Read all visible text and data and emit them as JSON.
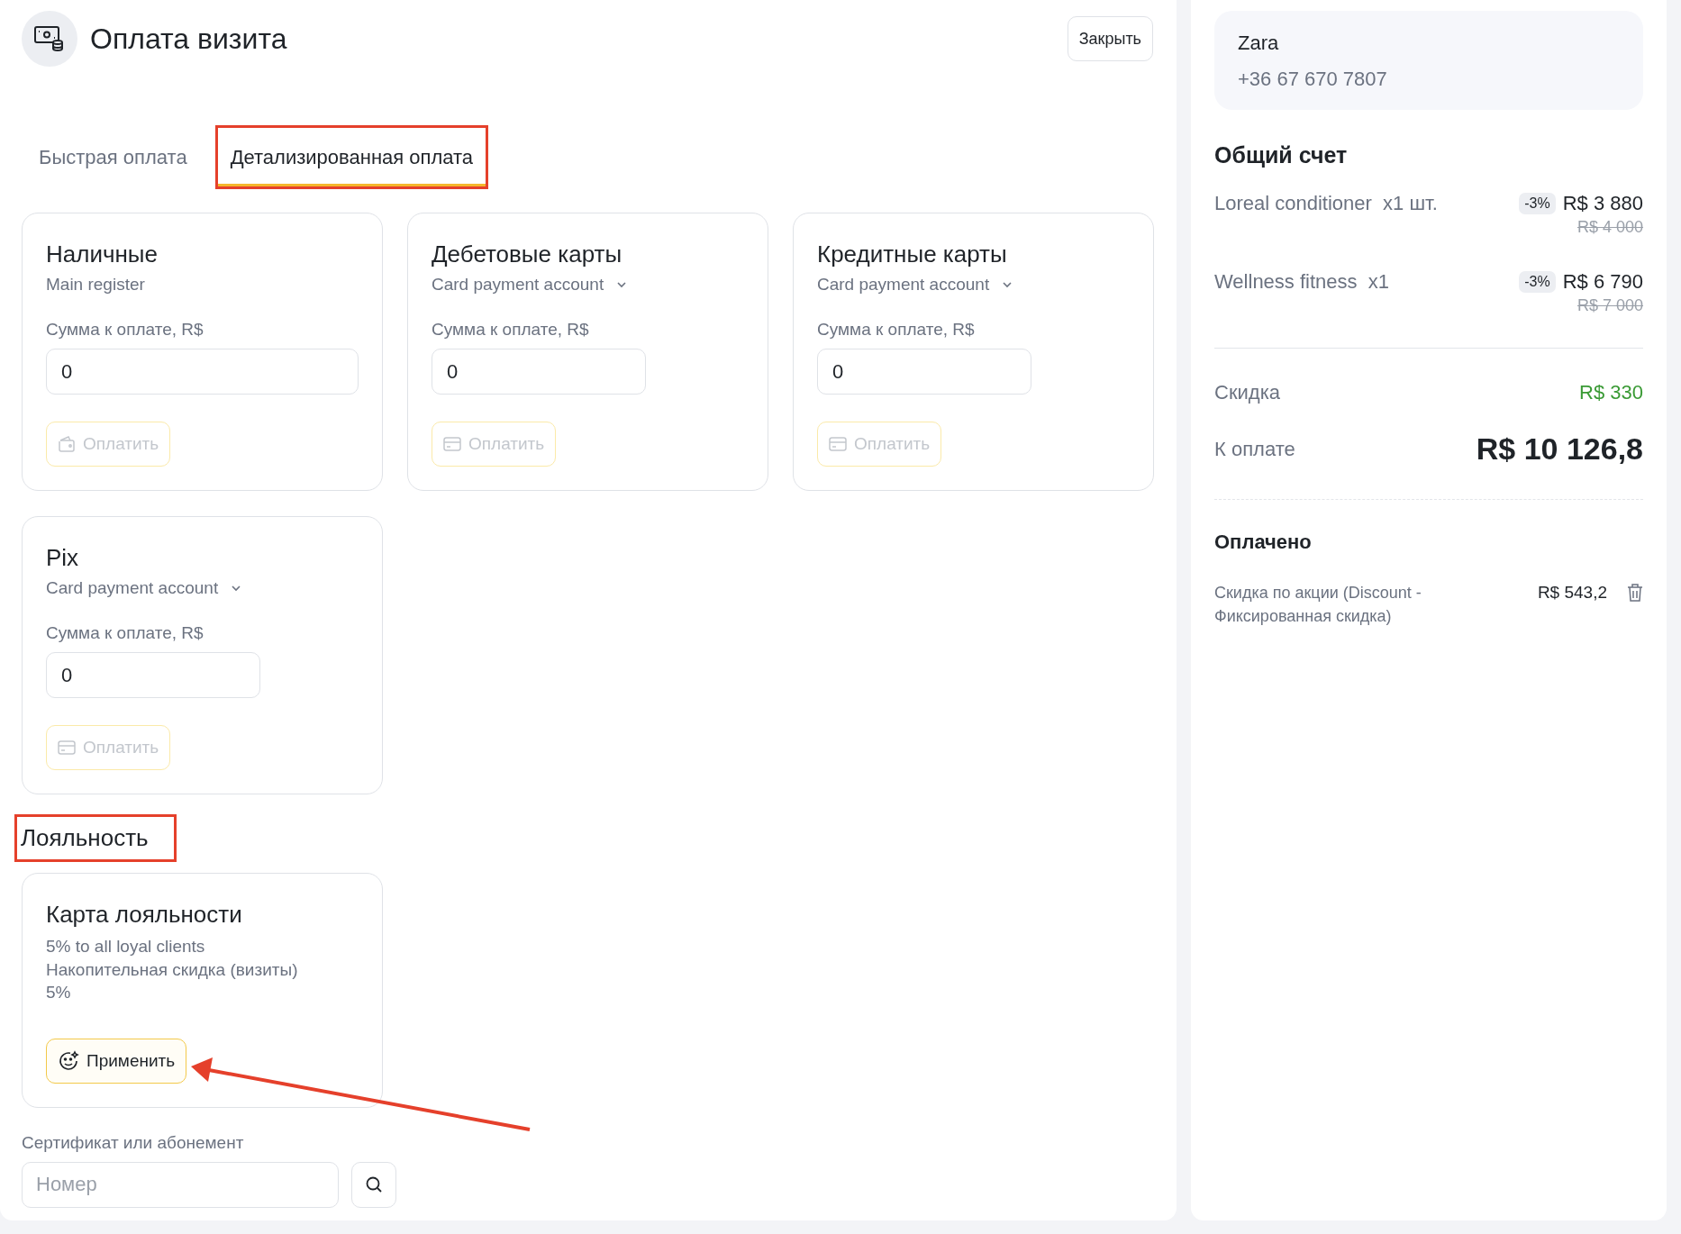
{
  "header": {
    "title": "Оплата визита",
    "close_button": "Закрыть"
  },
  "tabs": [
    {
      "label": "Быстрая оплата",
      "selected": false,
      "highlighted": false
    },
    {
      "label": "Детализированная оплата",
      "selected": true,
      "highlighted": true
    }
  ],
  "payment_methods": [
    {
      "kind": "cash",
      "title": "Наличные",
      "account": "Main register",
      "dropdown": false,
      "amount_label": "Сумма к оплате, R$",
      "amount": "0",
      "pay_button": "Оплатить",
      "disabled": true
    },
    {
      "kind": "card",
      "title": "Дебетовые карты",
      "account": "Card payment account",
      "dropdown": true,
      "amount_label": "Сумма к оплате, R$",
      "amount": "0",
      "pay_button": "Оплатить",
      "disabled": true
    },
    {
      "kind": "card",
      "title": "Кредитные карты",
      "account": "Card payment account",
      "dropdown": true,
      "amount_label": "Сумма к оплате, R$",
      "amount": "0",
      "pay_button": "Оплатить",
      "disabled": true
    },
    {
      "kind": "card",
      "title": "Pix",
      "account": "Card payment account",
      "dropdown": true,
      "amount_label": "Сумма к оплате, R$",
      "amount": "0",
      "pay_button": "Оплатить",
      "disabled": true
    }
  ],
  "loyalty": {
    "heading": "Лояльность",
    "heading_highlighted": true,
    "card": {
      "title": "Карта лояльности",
      "lines": [
        "5% to all loyal clients",
        "Накопительная скидка (визиты)",
        "5%"
      ],
      "apply_button": "Применить"
    }
  },
  "certificate": {
    "label": "Сертификат или абонемент",
    "placeholder": "Номер"
  },
  "client": {
    "name": "Zara",
    "phone": "+36 67 670 7807"
  },
  "bill": {
    "title": "Общий счет",
    "items": [
      {
        "name": "Loreal conditioner",
        "quantity": "x1 шт.",
        "discount": "-3%",
        "price": "R$ 3 880",
        "old_price": "R$ 4 000"
      },
      {
        "name": "Wellness fitness",
        "quantity": "x1",
        "discount": "-3%",
        "price": "R$ 6 790",
        "old_price": "R$ 7 000"
      }
    ],
    "discount_label": "Скидка",
    "discount_value": "R$ 330",
    "total_label": "К оплате",
    "total_value": "R$ 10 126,8"
  },
  "paid": {
    "title": "Оплачено",
    "entries": [
      {
        "description": "Скидка по акции (Discount - Фиксированная скидка)",
        "amount": "R$ 543,2"
      }
    ]
  }
}
